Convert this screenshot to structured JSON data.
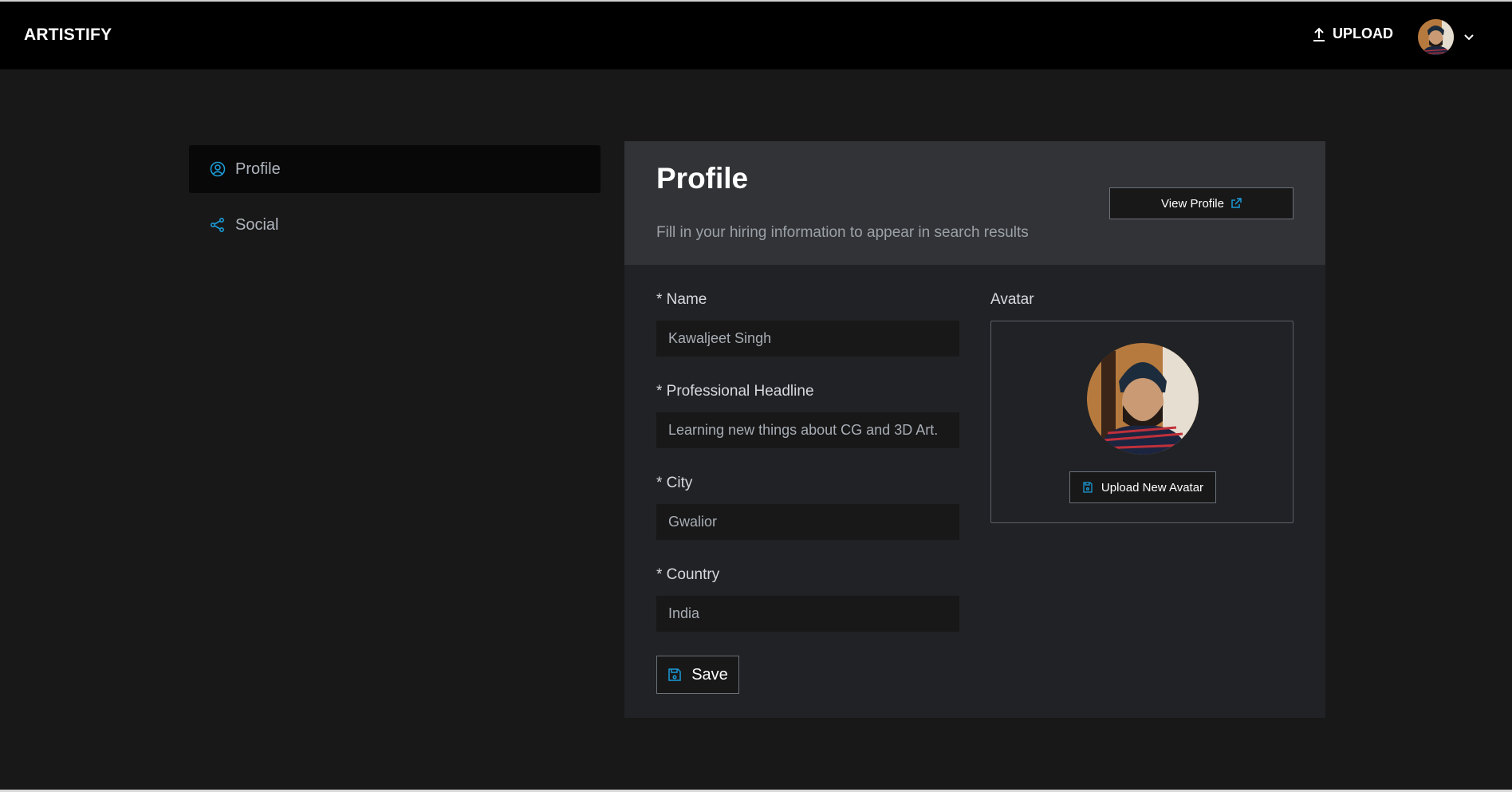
{
  "header": {
    "brand": "ARTISTIFY",
    "upload_label": "UPLOAD",
    "upload_icon": "upload-arrow-icon",
    "user_avatar_alt": "User avatar",
    "menu_icon": "chevron-down-icon"
  },
  "sidebar": {
    "items": [
      {
        "label": "Profile",
        "icon": "user-circle-icon",
        "active": true
      },
      {
        "label": "Social",
        "icon": "share-icon",
        "active": false
      }
    ]
  },
  "card": {
    "title": "Profile",
    "subtitle": "Fill in your hiring information to appear in search results",
    "view_profile_label": "View Profile",
    "view_profile_icon": "external-link-icon",
    "fields": [
      {
        "label": "* Name",
        "value": "Kawaljeet Singh"
      },
      {
        "label": "* Professional Headline",
        "value": "Learning new things about CG and 3D Art."
      },
      {
        "label": "* City",
        "value": "Gwalior"
      },
      {
        "label": "* Country",
        "value": "India"
      }
    ],
    "save_label": "Save",
    "save_icon": "floppy-disk-icon",
    "avatar_label": "Avatar",
    "upload_avatar_label": "Upload New Avatar"
  },
  "colors": {
    "accent": "#1a9bd7",
    "header_bg": "#000000",
    "page_bg": "#181818",
    "card_bg": "#212225",
    "card_head_bg": "#323336"
  }
}
